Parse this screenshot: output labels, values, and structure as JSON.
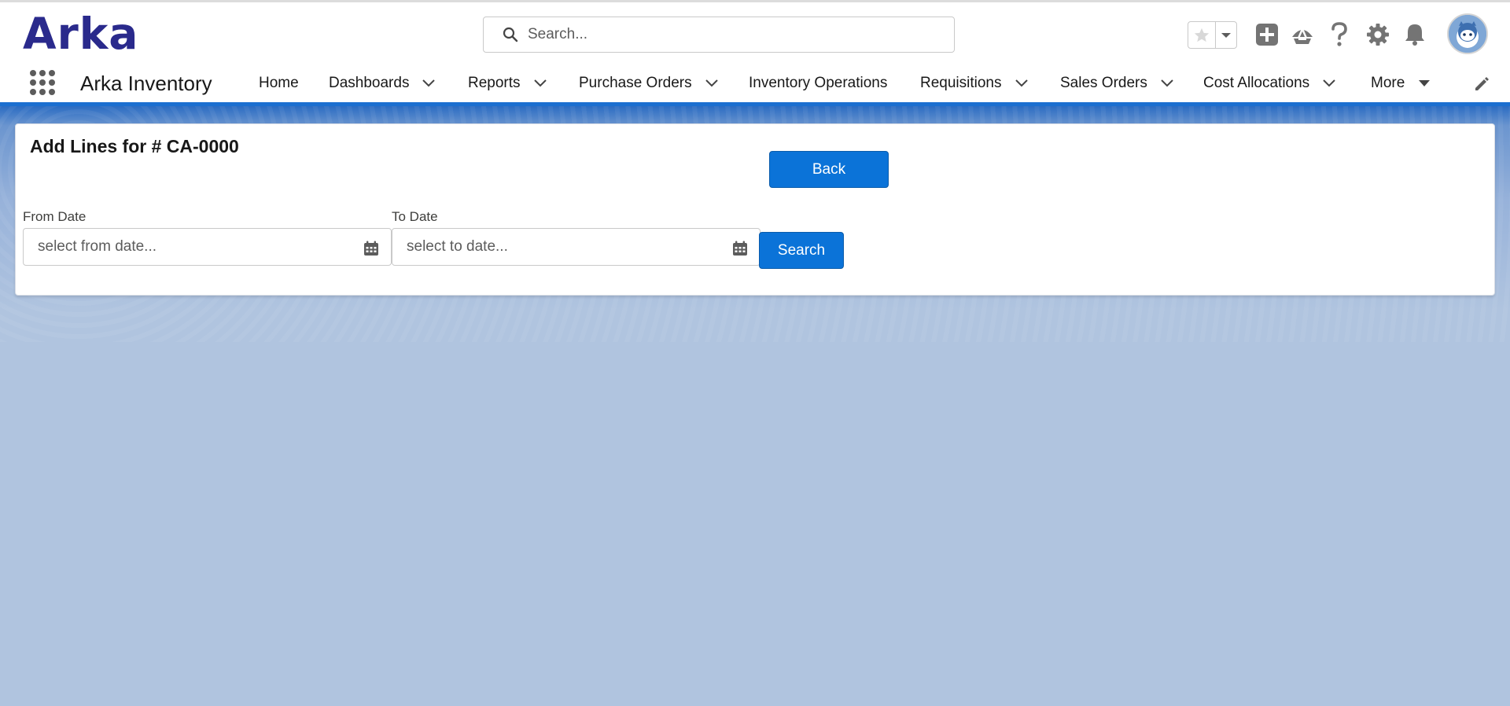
{
  "header": {
    "logo_text": "Arka",
    "search_placeholder": "Search...",
    "icons": [
      "star-icon",
      "chevron-down-icon",
      "add-icon",
      "trailhead-icon",
      "help-icon",
      "setup-gear-icon",
      "notification-bell-icon",
      "user-avatar"
    ],
    "brand_color": "#2a2a8c"
  },
  "nav": {
    "app_name": "Arka Inventory",
    "items": [
      {
        "label": "Home",
        "has_dropdown": false
      },
      {
        "label": "Dashboards",
        "has_dropdown": true
      },
      {
        "label": "Reports",
        "has_dropdown": true
      },
      {
        "label": "Purchase Orders",
        "has_dropdown": true
      },
      {
        "label": "Inventory Operations",
        "has_dropdown": false
      },
      {
        "label": "Requisitions",
        "has_dropdown": true
      },
      {
        "label": "Sales Orders",
        "has_dropdown": true
      },
      {
        "label": "Cost Allocations",
        "has_dropdown": true
      },
      {
        "label": "More",
        "has_dropdown": true
      }
    ],
    "accent_color": "#1b6fd0"
  },
  "card": {
    "title": "Add Lines for # CA-0000",
    "back_label": "Back",
    "from_date": {
      "label": "From Date",
      "placeholder": "select from date...",
      "value": ""
    },
    "to_date": {
      "label": "To Date",
      "placeholder": "select to date...",
      "value": ""
    },
    "search_label": "Search",
    "button_color": "#0b73d8"
  }
}
